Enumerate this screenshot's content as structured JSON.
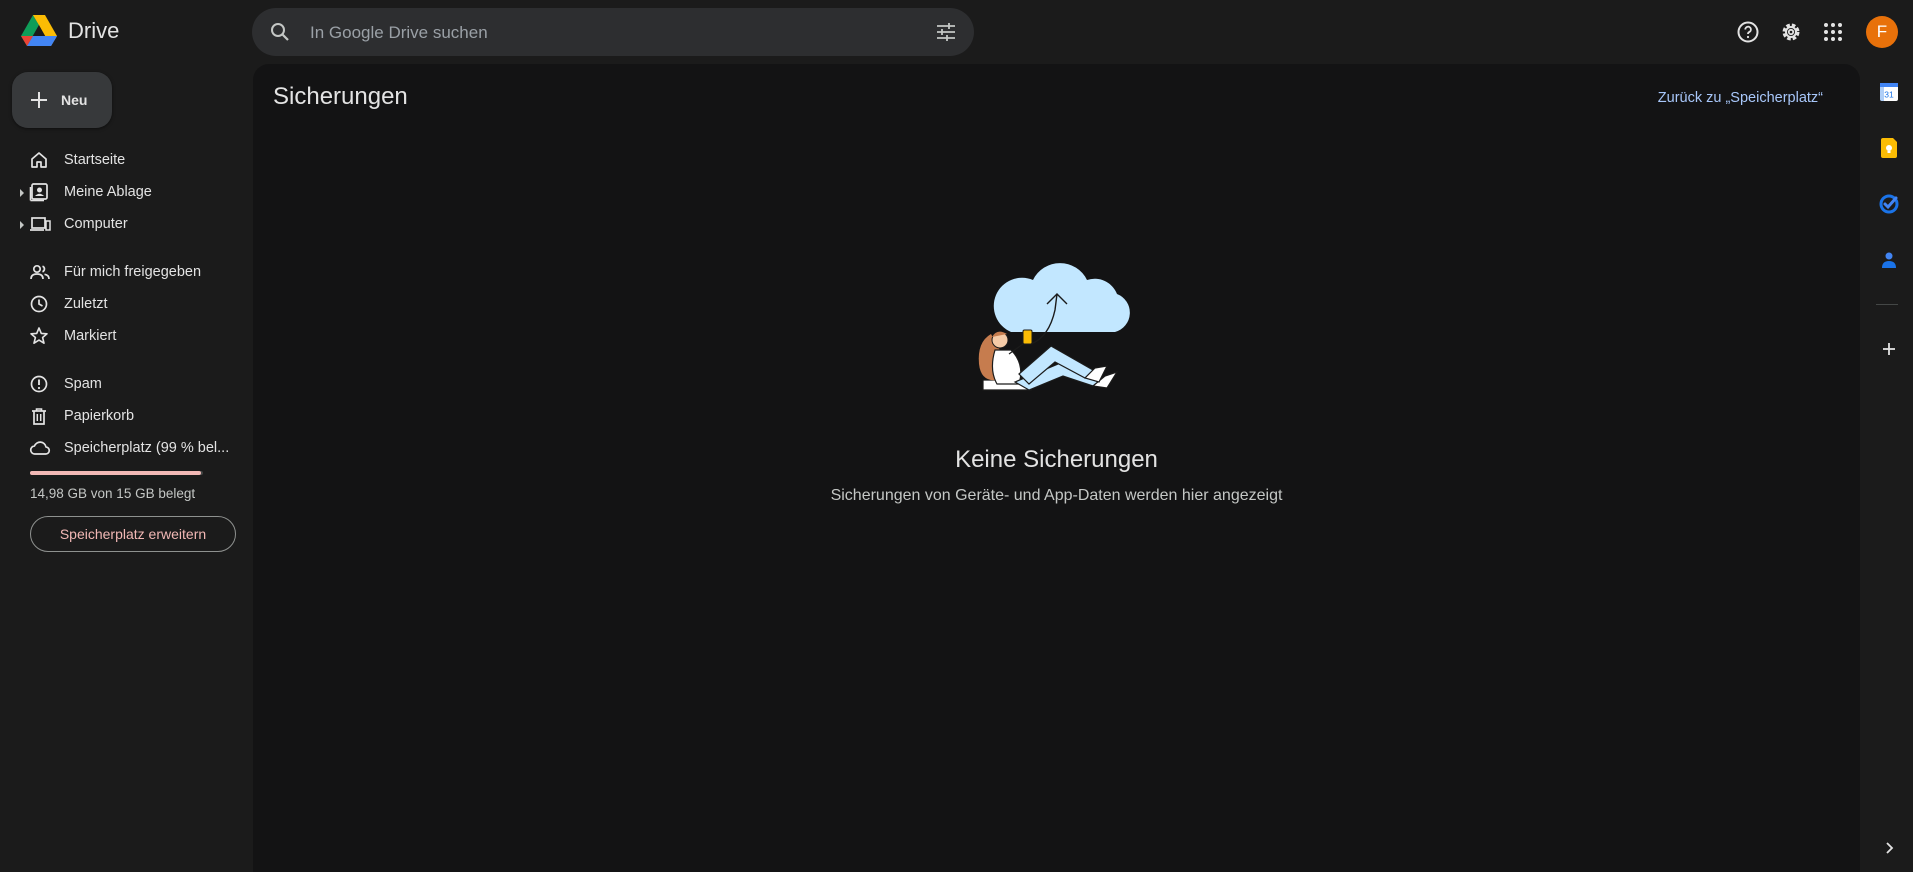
{
  "app": {
    "name": "Drive"
  },
  "search": {
    "placeholder": "In Google Drive suchen"
  },
  "header_icons": [
    "search-icon",
    "tune-icon",
    "help-icon",
    "gear-icon",
    "apps-icon"
  ],
  "account": {
    "initial": "F",
    "color": "#e8710a"
  },
  "new_button": {
    "label": "Neu"
  },
  "nav": {
    "home": "Startseite",
    "my_drive": "Meine Ablage",
    "computers": "Computer",
    "shared": "Für mich freigegeben",
    "recent": "Zuletzt",
    "starred": "Markiert",
    "spam": "Spam",
    "trash": "Papierkorb",
    "storage": "Speicherplatz (99 % bel..."
  },
  "storage": {
    "used_fraction": 0.99,
    "text": "14,98 GB von 15 GB belegt",
    "upgrade_label": "Speicherplatz erweitern"
  },
  "main": {
    "title": "Sicherungen",
    "back_link": "Zurück zu „Speicherplatz“",
    "empty_title": "Keine Sicherungen",
    "empty_subtitle": "Sicherungen von Geräte- und App-Daten werden hier angezeigt"
  },
  "side_panel": {
    "calendar_day": "31",
    "icons": [
      "calendar-icon",
      "keep-icon",
      "tasks-icon",
      "contacts-icon",
      "add-icon",
      "expand-icon"
    ]
  },
  "colors": {
    "background": "#1b1b1b",
    "main_surface": "#131314",
    "accent_link": "#a8c7fa",
    "storage_warning": "#f2b8b5"
  }
}
